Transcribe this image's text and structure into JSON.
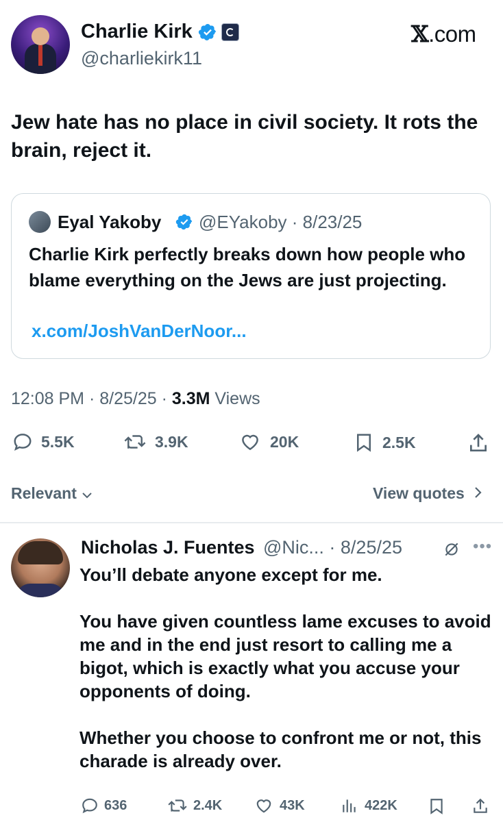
{
  "tweet": {
    "author": {
      "name": "Charlie Kirk",
      "handle": "@charliekirk11",
      "avatar_icon": "profile-photo",
      "verified_color": "#1d9bf0"
    },
    "site": {
      "x": "𝕏",
      "domain": ".com"
    },
    "text": "Jew hate has no place in civil society. It rots the brain, reject it.",
    "quoted": {
      "author_name": "Eyal Yakoby",
      "handle_date": "@EYakoby · 8/23/25",
      "text": "Charlie Kirk perfectly breaks down how people who blame everything on the Jews are just projecting.",
      "link": "x.com/JoshVanDerNoor..."
    },
    "timestamp": "12:08 PM · 8/25/25 · ",
    "views_count": "3.3M",
    "views_label": " Views",
    "stats": {
      "replies": "5.5K",
      "reposts": "3.9K",
      "likes": "20K",
      "bookmarks": "2.5K"
    }
  },
  "sort": {
    "label": "Relevant",
    "view_quotes": "View quotes"
  },
  "reply": {
    "author_name": "Nicholas J. Fuentes",
    "handle_date": "@Nic... · 8/25/25",
    "text": "You’ll debate anyone except for me.\n\nYou have given countless lame excuses to avoid me and in the end just resort to calling me a bigot, which is exactly what you accuse your opponents of doing.\n\nWhether you choose to confront me or not, this charade is already over.",
    "stats": {
      "replies": "636",
      "reposts": "2.4K",
      "likes": "43K",
      "views": "422K"
    }
  },
  "colors": {
    "accent": "#1d9bf0",
    "text": "#0f1419",
    "muted": "#536471",
    "border": "#cfd9de"
  }
}
